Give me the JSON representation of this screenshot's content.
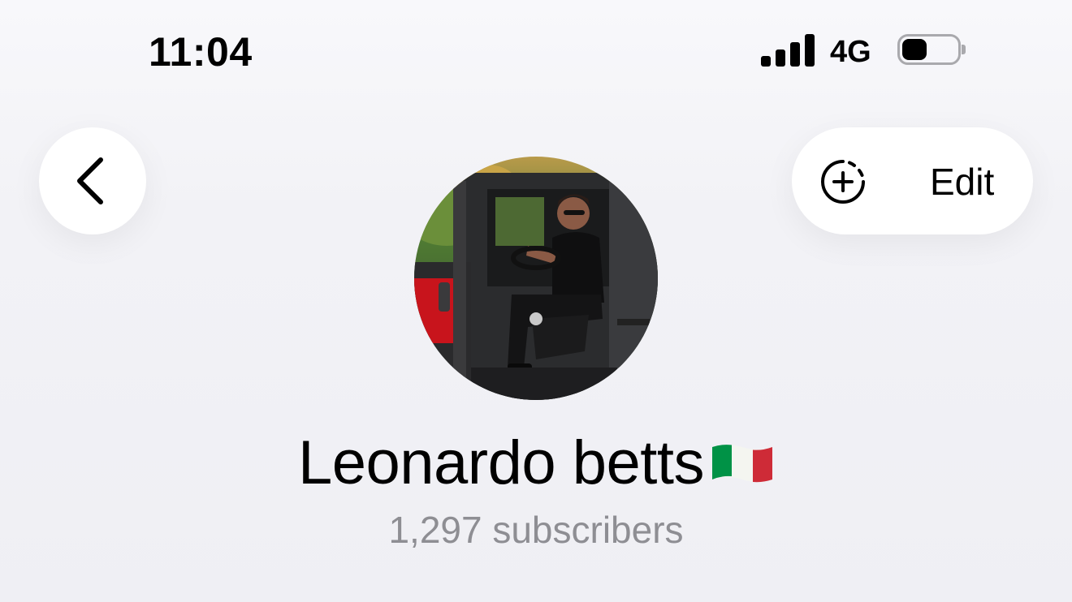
{
  "status_bar": {
    "time": "11:04",
    "network": "4G",
    "signal_bars_active": 4,
    "battery_level": 0.45,
    "icons": [
      "signal-icon",
      "battery-icon"
    ]
  },
  "header": {
    "back_icon": "chevron-left-icon",
    "add_story_icon": "dashed-circle-plus-icon",
    "edit_label": "Edit"
  },
  "profile": {
    "name": "Leonardo betts",
    "flag_icon": "italy-flag-icon",
    "subscribers": "1,297 subscribers"
  },
  "colors": {
    "background": "#f1f1f6",
    "secondary_text": "#8e8e93",
    "flag_green": "#009246",
    "flag_red": "#ce2b37"
  }
}
